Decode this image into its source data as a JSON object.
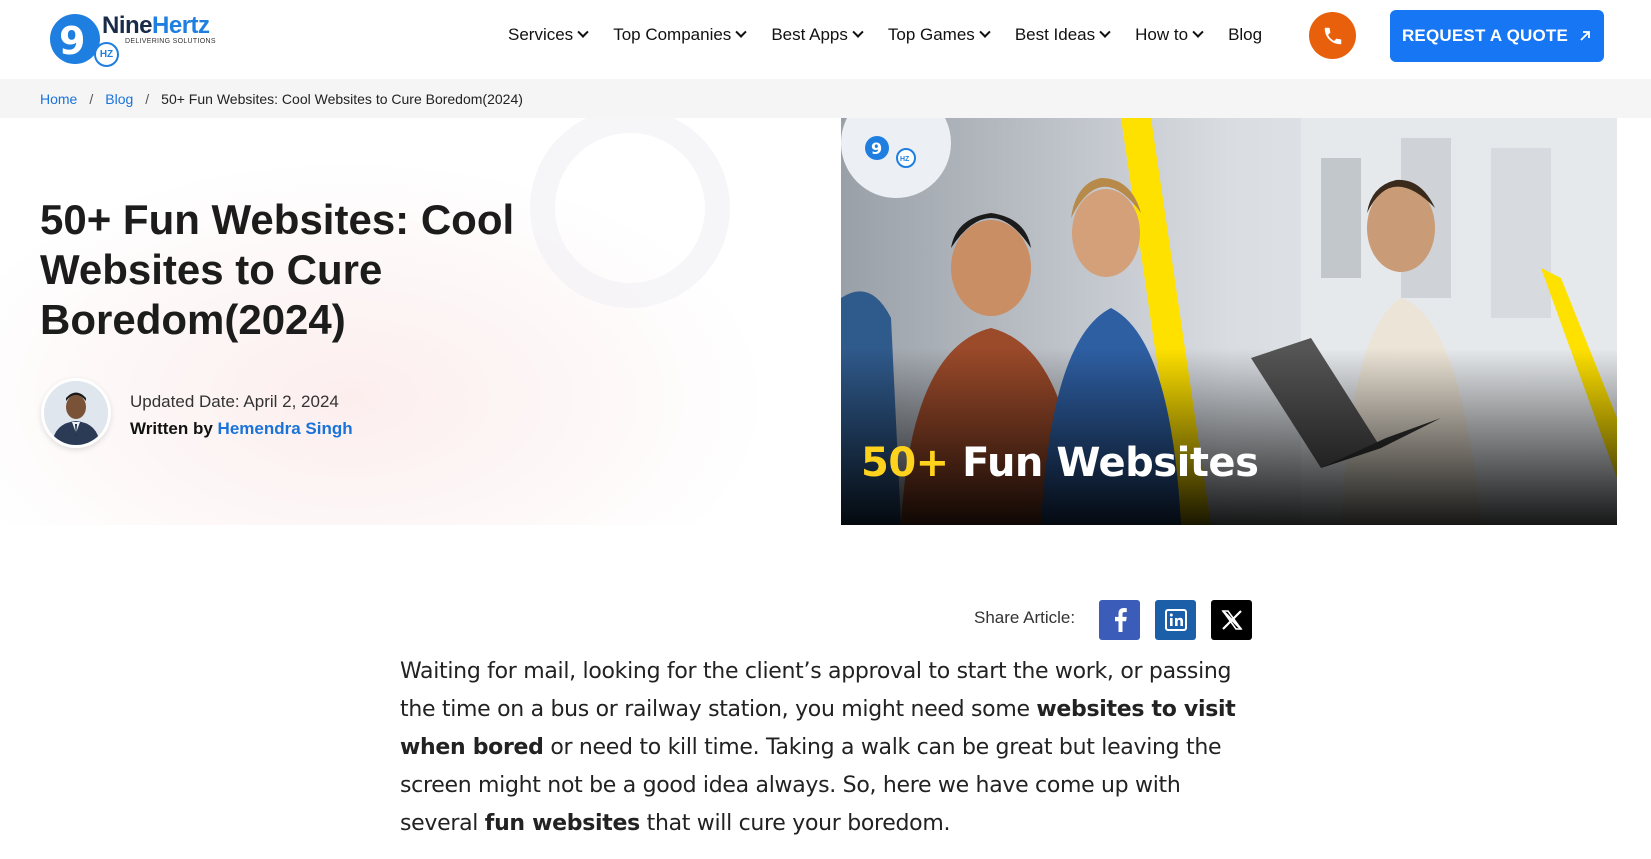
{
  "header": {
    "logo_name_a": "Nine",
    "logo_name_b": "Hertz",
    "logo_tagline": "DELIVERING SOLUTIONS",
    "logo_badge_9": "9",
    "logo_badge_hz": "HZ",
    "nav": [
      {
        "label": "Services",
        "dropdown": true
      },
      {
        "label": "Top Companies",
        "dropdown": true
      },
      {
        "label": "Best Apps",
        "dropdown": true
      },
      {
        "label": "Top Games",
        "dropdown": true
      },
      {
        "label": "Best Ideas",
        "dropdown": true
      },
      {
        "label": "How to",
        "dropdown": true
      },
      {
        "label": "Blog",
        "dropdown": false
      }
    ],
    "phone_icon": "phone-icon",
    "quote_label": "REQUEST A QUOTE",
    "quote_icon": "arrow-up-right-icon",
    "colors": {
      "phone_bg": "#e8600c",
      "quote_bg": "#1676f3",
      "link": "#1a73d9"
    }
  },
  "breadcrumb": {
    "home": "Home",
    "blog": "Blog",
    "separator": "/",
    "current": "50+ Fun Websites: Cool Websites to Cure Boredom(2024)"
  },
  "hero": {
    "title": "50+ Fun Websites: Cool Websites to Cure Boredom(2024)",
    "updated_label": "Updated Date: April 2, 2024",
    "written_by": "Written by",
    "author": "Hemendra Singh",
    "image_caption_num": "50+",
    "image_caption_text": "Fun Websites"
  },
  "share": {
    "label": "Share Article:",
    "icons": [
      "facebook-icon",
      "linkedin-icon",
      "x-twitter-icon"
    ]
  },
  "article": {
    "p1_a": "Waiting for mail, looking for the client’s approval to start the work, or passing the time on a bus or railway station, you might need some ",
    "p1_b": "websites to visit when bored",
    "p1_c": " or need to kill time. Taking a walk can be great but leaving the screen might not be a good idea always. So, here we have come up with several ",
    "p1_d": "fun websites",
    "p1_e": " that will cure your boredom."
  }
}
